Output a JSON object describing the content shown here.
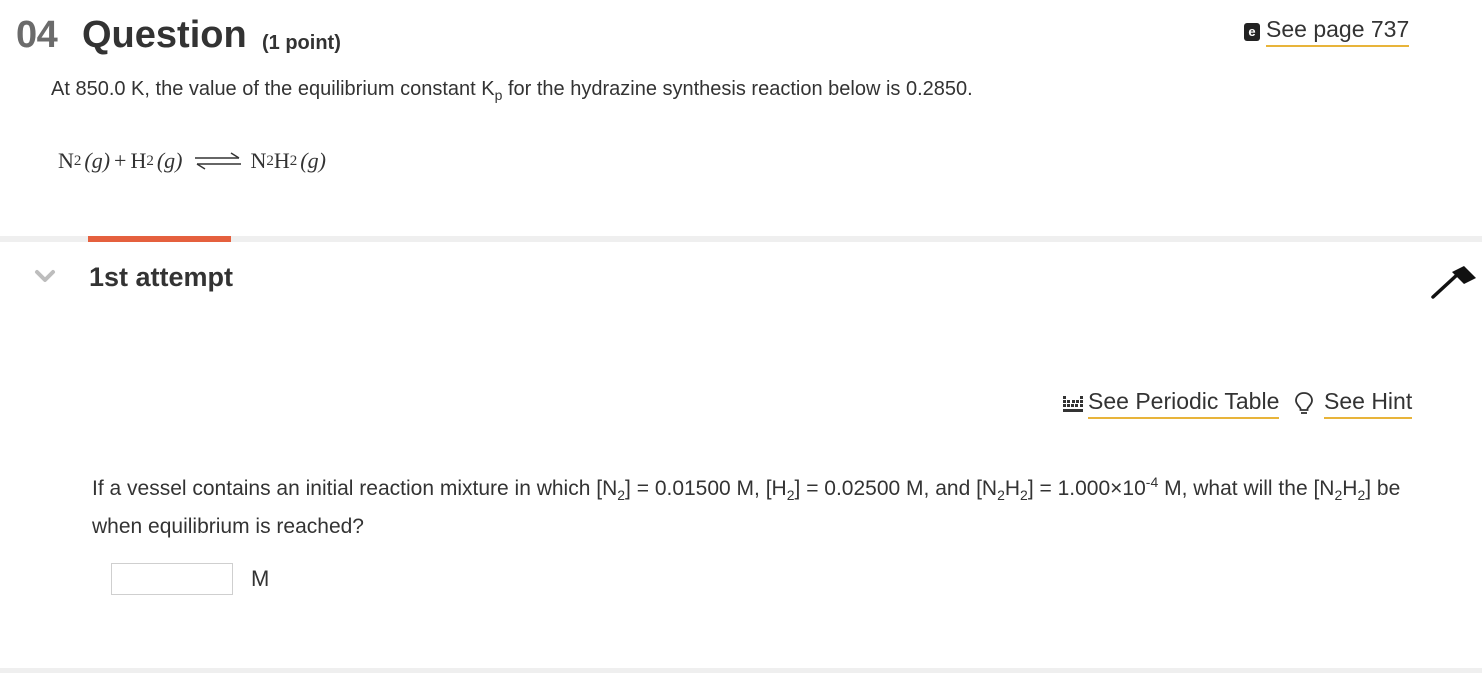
{
  "header": {
    "number": "04",
    "word": "Question",
    "points": "(1 point)",
    "see_page": "See page 737"
  },
  "intro": {
    "part1": "At 850.0 K, the value of the equilibrium constant K",
    "sub": "p",
    "part2": " for the hydrazine synthesis reaction below is 0.2850."
  },
  "equation": {
    "r1": "N",
    "r1_sub": "2",
    "r1_state": "(g)",
    "plus": "+",
    "r2": "H",
    "r2_sub": "2",
    "r2_state": "(g)",
    "p1": "N",
    "p1_sub": "2",
    "p2": "H",
    "p2_sub": "2",
    "p_state": "(g)"
  },
  "attempt": {
    "title": "1st attempt"
  },
  "tools": {
    "periodic_label": "See Periodic Table",
    "hint_label": "See Hint"
  },
  "question": {
    "t1": "If a vessel contains an initial reaction mixture in which [N",
    "s1": "2",
    "t2": "] = 0.01500 M, [H",
    "s2": "2",
    "t3": "] = 0.02500 M, and [N",
    "s3": "2",
    "t4": "H",
    "s4": "2",
    "t5": "] = 1.000×10",
    "sup1": "-4",
    "t6": " M, what will the [N",
    "s5": "2",
    "t7": "H",
    "s6": "2",
    "t8": "] be when equilibrium is reached?"
  },
  "answer": {
    "value": "",
    "unit": "M"
  },
  "colors": {
    "accent_tab": "#e5603e",
    "link_underline": "#e8b43a"
  },
  "icons": [
    "ebook-icon",
    "chevron-down-icon",
    "flag-icon",
    "periodic-table-icon",
    "lightbulb-icon"
  ]
}
